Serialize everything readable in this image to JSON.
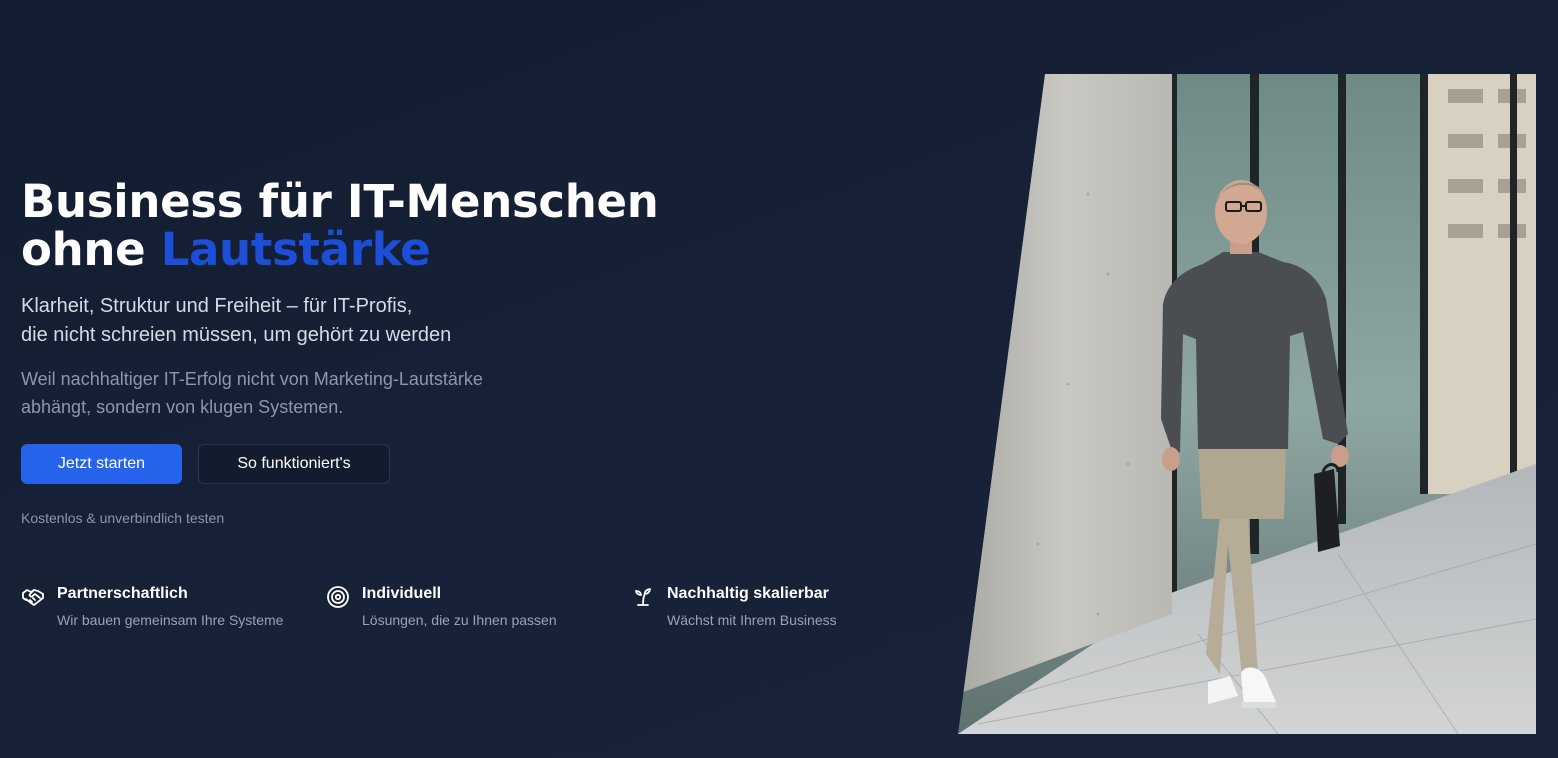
{
  "hero": {
    "title_line1": "Business für IT-Menschen",
    "title_line2_prefix": "ohne ",
    "title_accent": "Lautstärke",
    "subtitle_line1": "Klarheit, Struktur und Freiheit – für IT-Profis,",
    "subtitle_line2": "die nicht schreien müssen, um gehört zu werden",
    "description_line1": "Weil nachhaltiger IT-Erfolg nicht von Marketing-Lautstärke",
    "description_line2": "abhängt, sondern von klugen Systemen.",
    "primary_cta": "Jetzt starten",
    "secondary_cta": "So funktioniert's",
    "note": "Kostenlos & unverbindlich testen"
  },
  "features": [
    {
      "icon": "handshake-icon",
      "title": "Partnerschaftlich",
      "description": "Wir bauen gemeinsam Ihre Systeme"
    },
    {
      "icon": "target-icon",
      "title": "Individuell",
      "description": "Lösungen, die zu Ihnen passen"
    },
    {
      "icon": "sprout-icon",
      "title": "Nachhaltig skalierbar",
      "description": "Wächst mit Ihrem Business"
    }
  ],
  "colors": {
    "background": "#141e33",
    "accent": "#1d4ed8",
    "primary_button": "#2563eb",
    "muted_text": "#8d97a9"
  }
}
